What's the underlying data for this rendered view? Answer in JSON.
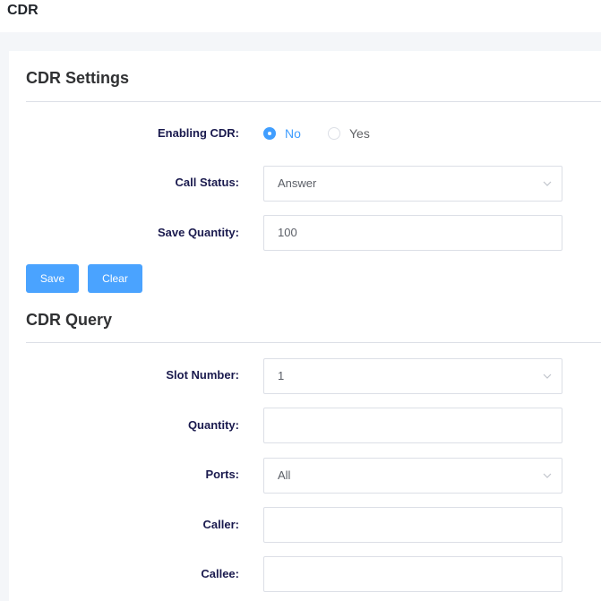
{
  "page": {
    "title": "CDR"
  },
  "settings": {
    "title": "CDR Settings",
    "enabling": {
      "label": "Enabling CDR:",
      "options": [
        {
          "label": "No",
          "checked": true
        },
        {
          "label": "Yes",
          "checked": false
        }
      ]
    },
    "call_status": {
      "label": "Call Status:",
      "value": "Answer"
    },
    "save_quantity": {
      "label": "Save Quantity:",
      "value": "100"
    },
    "buttons": {
      "save": "Save",
      "clear": "Clear"
    }
  },
  "query": {
    "title": "CDR Query",
    "slot_number": {
      "label": "Slot Number:",
      "value": "1"
    },
    "quantity": {
      "label": "Quantity:",
      "value": ""
    },
    "ports": {
      "label": "Ports:",
      "value": "All"
    },
    "caller": {
      "label": "Caller:",
      "value": ""
    },
    "callee": {
      "label": "Callee:",
      "value": ""
    }
  },
  "colors": {
    "accent": "#409eff",
    "button": "#4aa3ff",
    "label": "#1a1a4e"
  }
}
